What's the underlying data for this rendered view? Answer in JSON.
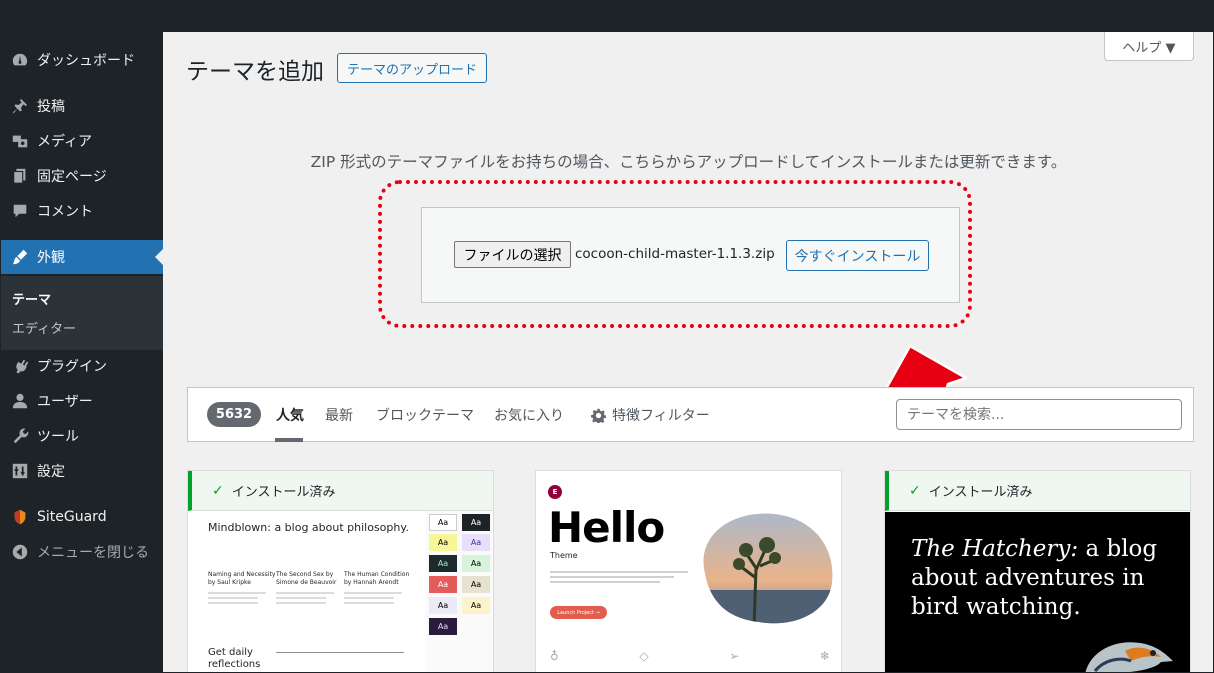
{
  "sidebar": {
    "items": [
      {
        "label": "ダッシュボード",
        "icon": "dashboard-icon"
      },
      {
        "label": "投稿",
        "icon": "pin-icon"
      },
      {
        "label": "メディア",
        "icon": "media-icon"
      },
      {
        "label": "固定ページ",
        "icon": "page-icon"
      },
      {
        "label": "コメント",
        "icon": "comment-icon"
      },
      {
        "label": "外観",
        "icon": "brush-icon"
      },
      {
        "label": "プラグイン",
        "icon": "plugin-icon"
      },
      {
        "label": "ユーザー",
        "icon": "user-icon"
      },
      {
        "label": "ツール",
        "icon": "wrench-icon"
      },
      {
        "label": "設定",
        "icon": "settings-icon"
      },
      {
        "label": "SiteGuard",
        "icon": "siteguard-icon"
      },
      {
        "label": "メニューを閉じる",
        "icon": "collapse-icon"
      }
    ],
    "submenu": [
      {
        "label": "テーマ"
      },
      {
        "label": "エディター"
      }
    ]
  },
  "header": {
    "help_label": "ヘルプ ▼",
    "title": "テーマを追加",
    "upload_button": "テーマのアップロード"
  },
  "upload": {
    "help_text": "ZIP 形式のテーマファイルをお持ちの場合、こちらからアップロードしてインストールまたは更新できます。",
    "choose_file_label": "ファイルの選択",
    "file_name": "cocoon-child-master-1.1.3.zip",
    "install_label": "今すぐインストール"
  },
  "filter": {
    "count": "5632",
    "tabs": [
      "人気",
      "最新",
      "ブロックテーマ",
      "お気に入り"
    ],
    "feature_filter": "特徴フィルター",
    "search_placeholder": "テーマを検索..."
  },
  "themes": [
    {
      "installed_label": "インストール済み",
      "preview": {
        "title": "Mindblown: a blog about philosophy.",
        "columns": [
          [
            "Naming and Necessity",
            "by Saul Kripke"
          ],
          [
            "The Second Sex by",
            "Simone de Beauvoir"
          ],
          [
            "The Human Condition",
            "by Hannah Arendt"
          ]
        ],
        "footer": [
          "Get daily",
          "reflections"
        ],
        "swatch_label": "Aa"
      }
    },
    {
      "preview": {
        "logo": "E",
        "title": "Hello",
        "subtitle": "Theme",
        "button": "Launch Project →"
      }
    },
    {
      "installed_label": "インストール済み",
      "preview": {
        "title_italic": "The Hatchery:",
        "title_rest": " a blog about adventures in bird watching."
      }
    }
  ],
  "colors": {
    "sidebar_bg": "#1d2327",
    "active_menu": "#2271b1",
    "accent": "#2271b1",
    "installed_green": "#00a32a",
    "annotation_red": "#e60012"
  }
}
